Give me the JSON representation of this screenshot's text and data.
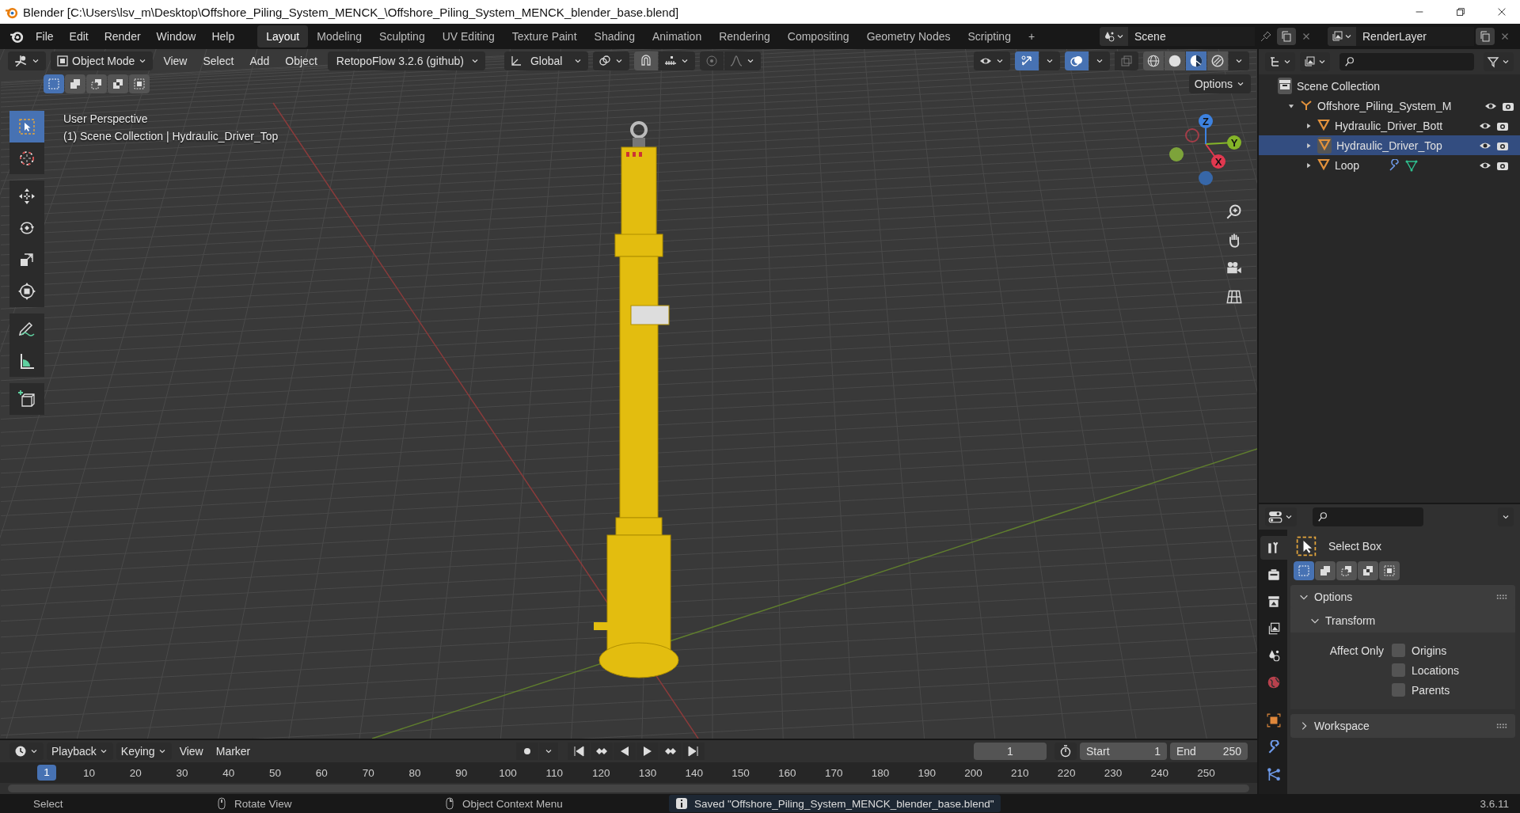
{
  "window": {
    "title": "Blender [C:\\Users\\lsv_m\\Desktop\\Offshore_Piling_System_MENCK_\\Offshore_Piling_System_MENCK_blender_base.blend]"
  },
  "menus": [
    "File",
    "Edit",
    "Render",
    "Window",
    "Help"
  ],
  "workspaces": [
    {
      "label": "Layout",
      "selected": true
    },
    {
      "label": "Modeling",
      "selected": false
    },
    {
      "label": "Sculpting",
      "selected": false
    },
    {
      "label": "UV Editing",
      "selected": false
    },
    {
      "label": "Texture Paint",
      "selected": false
    },
    {
      "label": "Shading",
      "selected": false
    },
    {
      "label": "Animation",
      "selected": false
    },
    {
      "label": "Rendering",
      "selected": false
    },
    {
      "label": "Compositing",
      "selected": false
    },
    {
      "label": "Geometry Nodes",
      "selected": false
    },
    {
      "label": "Scripting",
      "selected": false
    }
  ],
  "add_workspace": "+",
  "scene": {
    "name": "Scene",
    "view_layer": "RenderLayer"
  },
  "viewport": {
    "mode": "Object Mode",
    "menus": [
      "View",
      "Select",
      "Add",
      "Object"
    ],
    "addon": "RetopoFlow 3.2.6 (github)",
    "orientation": "Global",
    "options": "Options",
    "toggles": [
      {
        "kind": "gizmos",
        "on": true
      },
      {
        "kind": "overlays",
        "on": true
      },
      {
        "kind": "xray",
        "on": false
      }
    ],
    "shading": [
      {
        "kind": "wireframe",
        "selected": false
      },
      {
        "kind": "solid",
        "selected": false
      },
      {
        "kind": "material",
        "selected": true
      },
      {
        "kind": "rendered",
        "selected": false
      }
    ],
    "select_modes": [
      {
        "kind": "new",
        "selected": true
      },
      {
        "kind": "extend",
        "selected": false
      },
      {
        "kind": "subtract",
        "selected": false
      },
      {
        "kind": "invert",
        "selected": false
      },
      {
        "kind": "intersect",
        "selected": false
      }
    ],
    "tools": [
      {
        "kind": "select-box",
        "selected": true
      },
      {
        "kind": "cursor",
        "selected": false
      },
      {
        "kind": "move",
        "selected": false
      },
      {
        "kind": "rotate",
        "selected": false
      },
      {
        "kind": "scale",
        "selected": false
      },
      {
        "kind": "transform",
        "selected": false
      },
      {
        "kind": "annotate",
        "selected": false
      },
      {
        "kind": "measure",
        "selected": false
      },
      {
        "kind": "add-cube",
        "selected": false
      }
    ],
    "overlay_text": [
      "User Perspective",
      "(1) Scene Collection | Hydraulic_Driver_Top"
    ],
    "gizmo_axes": [
      "X",
      "Y",
      "Z"
    ]
  },
  "outliner": {
    "root": "Scene Collection",
    "items": [
      {
        "name": "Offshore_Piling_System_M",
        "kind": "empty",
        "expanded": true,
        "active": false,
        "children": [
          {
            "name": "Hydraulic_Driver_Bott",
            "kind": "mesh",
            "expanded": false,
            "active": false
          },
          {
            "name": "Hydraulic_Driver_Top",
            "kind": "mesh",
            "expanded": false,
            "active": true
          },
          {
            "name": "Loop",
            "kind": "mesh",
            "expanded": false,
            "active": false,
            "extra_icons": [
              {
                "kind": "modifier"
              },
              {
                "kind": "mesh-data"
              }
            ]
          }
        ]
      }
    ]
  },
  "properties": {
    "tabs": [
      {
        "kind": "tool",
        "selected": true
      },
      {
        "kind": "render",
        "selected": false
      },
      {
        "kind": "output",
        "selected": false
      },
      {
        "kind": "view-layer",
        "selected": false
      },
      {
        "kind": "scene",
        "selected": false
      },
      {
        "kind": "world",
        "selected": false
      },
      {
        "kind": "object",
        "selected": false
      },
      {
        "kind": "modifier",
        "selected": false
      },
      {
        "kind": "particles",
        "selected": false
      }
    ],
    "tool_name": "Select Box",
    "panels": [
      {
        "title": "Options",
        "expanded": true,
        "subpanel": {
          "title": "Transform",
          "expanded": true,
          "label": "Affect Only",
          "checkboxes": [
            {
              "label": "Origins",
              "checked": false
            },
            {
              "label": "Locations",
              "checked": false
            },
            {
              "label": "Parents",
              "checked": false
            }
          ]
        }
      },
      {
        "title": "Workspace",
        "expanded": false
      }
    ]
  },
  "timeline": {
    "menus": [
      "Playback",
      "Keying",
      "View",
      "Marker"
    ],
    "current_frame": "1",
    "start_label": "Start",
    "start": "1",
    "end_label": "End",
    "end": "250",
    "playhead": "1",
    "ticks": [
      "10",
      "20",
      "30",
      "40",
      "50",
      "60",
      "70",
      "80",
      "90",
      "100",
      "110",
      "120",
      "130",
      "140",
      "150",
      "160",
      "170",
      "180",
      "190",
      "200",
      "210",
      "220",
      "230",
      "240",
      "250"
    ]
  },
  "status_bar": {
    "hints": [
      "Select",
      "Rotate View",
      "Object Context Menu"
    ],
    "message": "Saved \"Offshore_Piling_System_MENCK_blender_base.blend\"",
    "version": "3.6.11"
  }
}
